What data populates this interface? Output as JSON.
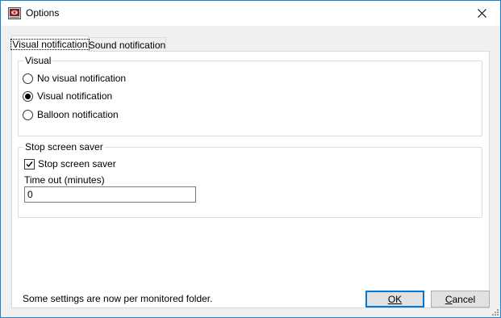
{
  "window": {
    "title": "Options",
    "close_glyph": "✕",
    "app_icon": "options-app-icon"
  },
  "tabs": [
    {
      "label": "Visual notification",
      "active": true
    },
    {
      "label": "Sound notification",
      "active": false
    }
  ],
  "visual_group": {
    "label": "Visual",
    "options": [
      {
        "label": "No visual notification",
        "checked": false
      },
      {
        "label": "Visual notification",
        "checked": true
      },
      {
        "label": "Balloon notification",
        "checked": false
      }
    ]
  },
  "saver_group": {
    "label": "Stop screen saver",
    "checkbox_label": "Stop screen saver",
    "checkbox_checked": true,
    "timeout_label": "Time out (minutes)",
    "timeout_value": "0"
  },
  "footer": {
    "message": "Some settings are now per monitored folder.",
    "ok_label": "OK",
    "ok_mnemonic": "O",
    "cancel_label": "Cancel",
    "cancel_mnemonic": "C"
  },
  "colors": {
    "window_border": "#1883d7",
    "focus_button_border": "#0078d7"
  }
}
